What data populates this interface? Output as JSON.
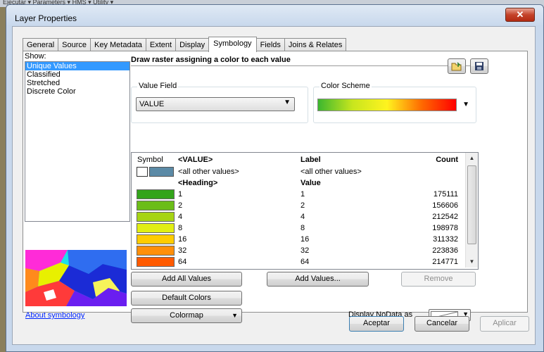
{
  "background_strip": "Ejecutar ▾  Parameters ▾  HMS ▾  Utility ▾",
  "window": {
    "title": "Layer Properties",
    "close_label": "✕"
  },
  "tabs": [
    "General",
    "Source",
    "Key Metadata",
    "Extent",
    "Display",
    "Symbology",
    "Fields",
    "Joins & Relates"
  ],
  "active_tab": "Symbology",
  "show": {
    "label": "Show:",
    "items": [
      "Unique Values",
      "Classified",
      "Stretched",
      "Discrete Color"
    ],
    "selected": "Unique Values"
  },
  "header_text": "Draw raster assigning a color to each value",
  "value_field": {
    "label": "Value Field",
    "value": "VALUE"
  },
  "color_scheme": {
    "label": "Color Scheme",
    "gradient": [
      "#3cb72f",
      "#c8e61e",
      "#fff31f",
      "#ff6a00",
      "#ff0000"
    ]
  },
  "table": {
    "headers": [
      "Symbol",
      "<VALUE>",
      "Label",
      "Count"
    ],
    "other_row": {
      "value": "<all other values>",
      "label": "<all other values>",
      "swatch": "#5b8aa6"
    },
    "heading_row": {
      "value": "<Heading>",
      "label": "Value"
    },
    "rows": [
      {
        "value": "1",
        "label": "1",
        "count": "175111",
        "color": "#33a41a"
      },
      {
        "value": "2",
        "label": "2",
        "count": "156606",
        "color": "#6bbd18"
      },
      {
        "value": "4",
        "label": "4",
        "count": "212542",
        "color": "#a6d414"
      },
      {
        "value": "8",
        "label": "8",
        "count": "198978",
        "color": "#e1ee14"
      },
      {
        "value": "16",
        "label": "16",
        "count": "311332",
        "color": "#ffcc00"
      },
      {
        "value": "32",
        "label": "32",
        "count": "223836",
        "color": "#ff8f0a"
      },
      {
        "value": "64",
        "label": "64",
        "count": "214771",
        "color": "#ff5a00"
      }
    ]
  },
  "buttons": {
    "add_all": "Add All Values",
    "add_values": "Add Values...",
    "remove": "Remove",
    "default_colors": "Default Colors",
    "colormap": "Colormap"
  },
  "about_link": "About symbology",
  "nodata_label": "Display NoData as",
  "footer": {
    "ok": "Aceptar",
    "cancel": "Cancelar",
    "apply": "Aplicar"
  }
}
